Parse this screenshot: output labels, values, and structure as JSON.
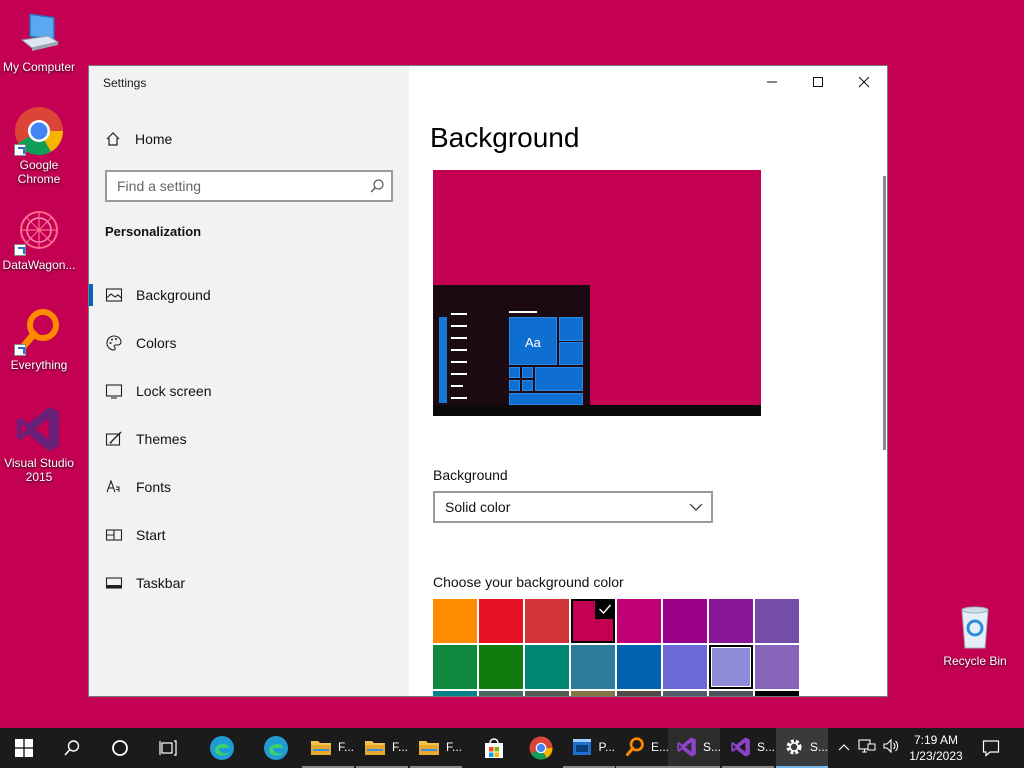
{
  "desktop": {
    "icons": [
      {
        "label": "My Computer"
      },
      {
        "label": "Google Chrome"
      },
      {
        "label": "DataWagon..."
      },
      {
        "label": "Everything"
      },
      {
        "label": "Visual Studio 2015"
      },
      {
        "label": "Recycle Bin"
      }
    ],
    "background_color": "#C30052"
  },
  "window": {
    "title": "Settings",
    "controls": [
      "minimize-icon",
      "maximize-icon",
      "close-icon"
    ]
  },
  "sidebar": {
    "home_label": "Home",
    "search_placeholder": "Find a setting",
    "section_title": "Personalization",
    "items": [
      {
        "label": "Background",
        "icon": "picture-icon",
        "active": true
      },
      {
        "label": "Colors",
        "icon": "palette-icon"
      },
      {
        "label": "Lock screen",
        "icon": "lock-screen-icon"
      },
      {
        "label": "Themes",
        "icon": "themes-icon"
      },
      {
        "label": "Fonts",
        "icon": "fonts-icon"
      },
      {
        "label": "Start",
        "icon": "start-icon"
      },
      {
        "label": "Taskbar",
        "icon": "taskbar-icon"
      }
    ]
  },
  "main": {
    "title": "Background",
    "preview_text": "Aa",
    "background_label": "Background",
    "background_value": "Solid color",
    "color_label": "Choose your background color",
    "selected_color": "#C30052",
    "swatches_row1": [
      "#FF8C00",
      "#E81123",
      "#D13438",
      "#C30052",
      "#BF0077",
      "#9A0089",
      "#881798",
      "#744DA9"
    ],
    "swatches_row2": [
      "#10893E",
      "#107C10",
      "#018574",
      "#2D7D9A",
      "#0063B1",
      "#6B69D6",
      "#8E8CD8",
      "#8764B8"
    ],
    "swatches_row3": [
      "#038387",
      "#486860",
      "#525E54",
      "#847545",
      "#4C4A48",
      "#515C6B",
      "#4A5459",
      "#000000"
    ]
  },
  "taskbar": {
    "apps": [
      {
        "label": "F...",
        "icon": "folder-icon"
      },
      {
        "label": "F...",
        "icon": "folder-icon"
      },
      {
        "label": "F...",
        "icon": "folder-icon"
      },
      {
        "label": "P...",
        "icon": "powershell-icon"
      },
      {
        "label": "E...",
        "icon": "everything-icon"
      },
      {
        "label": "S...",
        "icon": "visual-studio-icon"
      },
      {
        "label": "S...",
        "icon": "visual-studio-icon"
      },
      {
        "label": "S...",
        "icon": "settings-gear-icon"
      }
    ],
    "time": "7:19 AM",
    "date": "1/23/2023"
  }
}
